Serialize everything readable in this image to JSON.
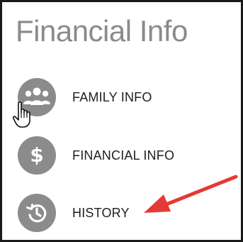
{
  "panel": {
    "title": "Financial Info"
  },
  "menu": {
    "items": [
      {
        "label": "FAMILY INFO",
        "icon": "family-icon"
      },
      {
        "label": "FINANCIAL INFO",
        "icon": "dollar-icon",
        "glyph": "$"
      },
      {
        "label": "HISTORY",
        "icon": "history-icon"
      }
    ]
  },
  "annotation": {
    "arrow_color": "#e53935",
    "cursor": "hand-pointer-icon"
  },
  "colors": {
    "icon_background": "#8b8b8b",
    "title": "#8a8a8a",
    "label": "#1f1f1f",
    "border": "#1a1a1a"
  }
}
